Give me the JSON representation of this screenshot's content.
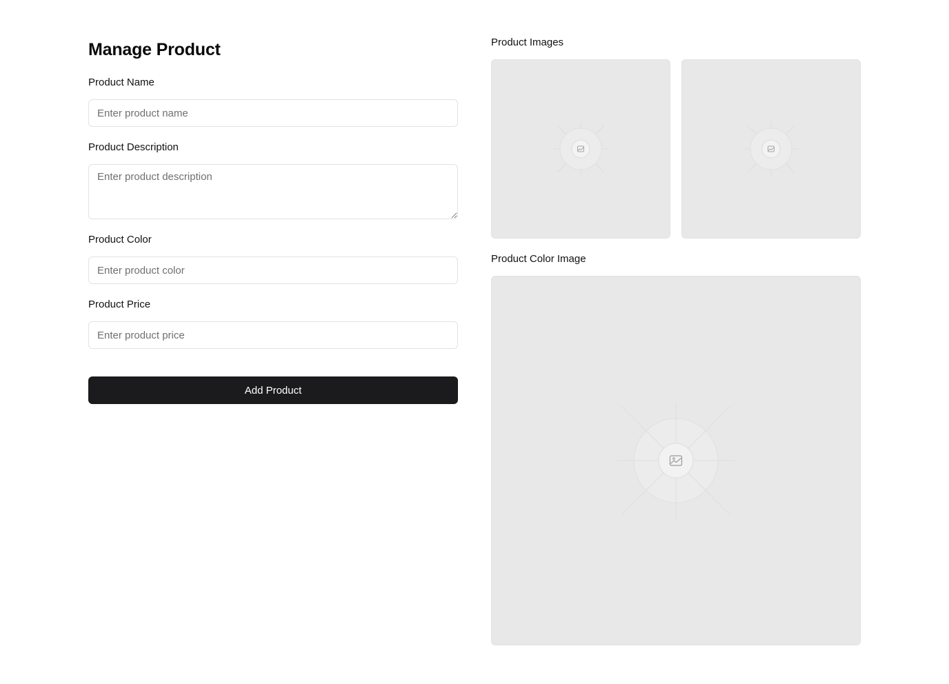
{
  "form": {
    "title": "Manage Product",
    "fields": {
      "name": {
        "label": "Product Name",
        "placeholder": "Enter product name",
        "value": ""
      },
      "description": {
        "label": "Product Description",
        "placeholder": "Enter product description",
        "value": ""
      },
      "color": {
        "label": "Product Color",
        "placeholder": "Enter product color",
        "value": ""
      },
      "price": {
        "label": "Product Price",
        "placeholder": "Enter product price",
        "value": ""
      }
    },
    "submit_label": "Add Product"
  },
  "media": {
    "images_label": "Product Images",
    "color_image_label": "Product Color Image",
    "placeholder_icon": "image-icon"
  },
  "colors": {
    "button_bg": "#1b1b1d",
    "button_text": "#ffffff",
    "placeholder_bg": "#e8e8e8",
    "input_border": "#e2e2e4"
  }
}
